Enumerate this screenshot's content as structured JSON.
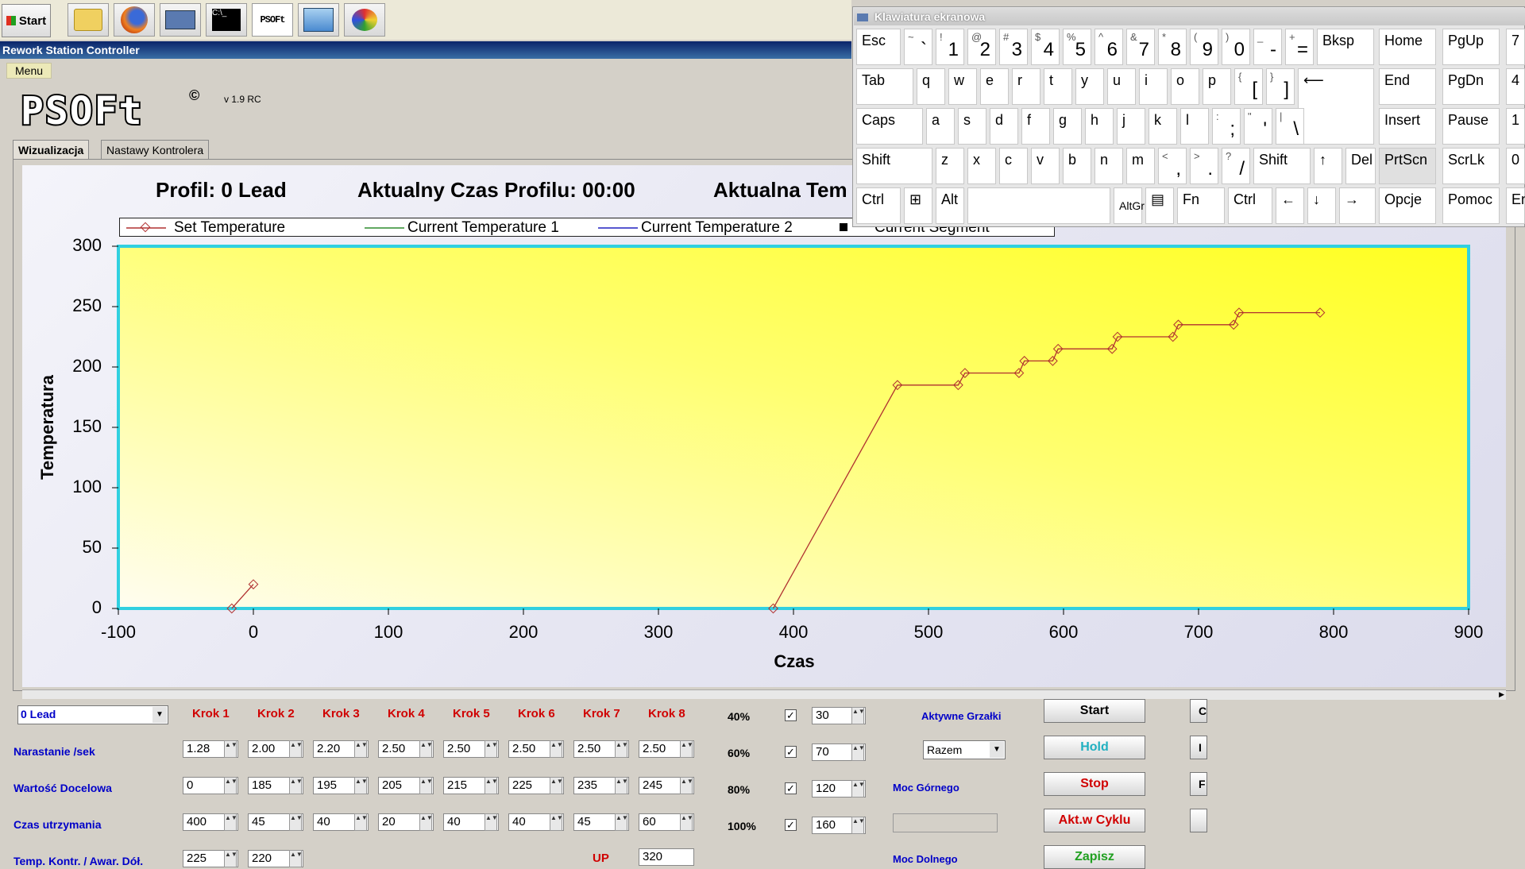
{
  "taskbar": {
    "start_label": "Start",
    "psoft_label": "PSOFt"
  },
  "window": {
    "title": "Rework Station Controller",
    "menu_label": "Menu",
    "logo_text": "PSOFt",
    "copyright": "©",
    "version": "v 1.9 RC"
  },
  "tabs": [
    {
      "label": "Wizualizacja"
    },
    {
      "label": "Nastawy Kontrolera"
    }
  ],
  "header": {
    "profil": "Profil: 0 Lead",
    "czas": "Aktualny Czas Profilu: 00:00",
    "temp": "Aktualna Tem"
  },
  "legend": [
    {
      "label": "Set Temperature",
      "color": "#b03030"
    },
    {
      "label": "Current Temperature 1",
      "color": "#2e8b2e"
    },
    {
      "label": "Current Temperature 2",
      "color": "#2020c0"
    },
    {
      "label": "Current Segment",
      "color": "#000000"
    }
  ],
  "chart_data": {
    "type": "line",
    "xlabel": "Czas",
    "ylabel": "Temperatura",
    "xlim": [
      -100,
      900
    ],
    "ylim": [
      0,
      300
    ],
    "xticks": [
      -100,
      0,
      100,
      200,
      300,
      400,
      500,
      600,
      700,
      800,
      900
    ],
    "yticks": [
      0,
      50,
      100,
      150,
      200,
      250,
      300
    ],
    "series": [
      {
        "name": "Set Temperature",
        "color": "#b03030",
        "segments": [
          [
            [
              -16,
              0
            ],
            [
              0,
              20
            ]
          ],
          [
            [
              385,
              0
            ],
            [
              477,
              185
            ],
            [
              522,
              185
            ],
            [
              527,
              195
            ],
            [
              567,
              195
            ],
            [
              571,
              205
            ],
            [
              592,
              205
            ],
            [
              596,
              215
            ],
            [
              636,
              215
            ],
            [
              640,
              225
            ],
            [
              681,
              225
            ],
            [
              685,
              235
            ],
            [
              726,
              235
            ],
            [
              730,
              245
            ],
            [
              790,
              245
            ]
          ]
        ]
      }
    ]
  },
  "keyboard": {
    "title": "Klawiatura ekranowa",
    "rows": [
      [
        {
          "t": "Esc"
        },
        {
          "s": "~",
          "l": "`"
        },
        {
          "s": "!",
          "l": "1"
        },
        {
          "s": "@",
          "l": "2"
        },
        {
          "s": "#",
          "l": "3"
        },
        {
          "s": "$",
          "l": "4"
        },
        {
          "s": "%",
          "l": "5"
        },
        {
          "s": "^",
          "l": "6"
        },
        {
          "s": "&",
          "l": "7"
        },
        {
          "s": "*",
          "l": "8"
        },
        {
          "s": "(",
          "l": "9"
        },
        {
          "s": ")",
          "l": "0"
        },
        {
          "s": "_",
          "l": "-"
        },
        {
          "s": "+",
          "l": "="
        },
        {
          "t": "Bksp"
        },
        {
          "t": "Home"
        },
        {
          "t": "PgUp"
        },
        {
          "t": "7"
        }
      ],
      [
        {
          "t": "Tab"
        },
        {
          "t": "q"
        },
        {
          "t": "w"
        },
        {
          "t": "e"
        },
        {
          "t": "r"
        },
        {
          "t": "t"
        },
        {
          "t": "y"
        },
        {
          "t": "u"
        },
        {
          "t": "i"
        },
        {
          "t": "o"
        },
        {
          "t": "p"
        },
        {
          "s": "{",
          "l": "["
        },
        {
          "s": "}",
          "l": "]"
        },
        {
          "t": "⟵"
        },
        {
          "t": "End"
        },
        {
          "t": "PgDn"
        },
        {
          "t": "4"
        }
      ],
      [
        {
          "t": "Caps"
        },
        {
          "t": "a"
        },
        {
          "t": "s"
        },
        {
          "t": "d"
        },
        {
          "t": "f"
        },
        {
          "t": "g"
        },
        {
          "t": "h"
        },
        {
          "t": "j"
        },
        {
          "t": "k"
        },
        {
          "t": "l"
        },
        {
          "s": ":",
          "l": ";"
        },
        {
          "s": "\"",
          "l": "'"
        },
        {
          "s": "|",
          "l": "\\"
        },
        {
          "t": "Insert"
        },
        {
          "t": "Pause"
        },
        {
          "t": "1"
        }
      ],
      [
        {
          "t": "Shift"
        },
        {
          "t": "z"
        },
        {
          "t": "x"
        },
        {
          "t": "c"
        },
        {
          "t": "v"
        },
        {
          "t": "b"
        },
        {
          "t": "n"
        },
        {
          "t": "m"
        },
        {
          "s": "<",
          "l": ","
        },
        {
          "s": ">",
          "l": "."
        },
        {
          "s": "?",
          "l": "/"
        },
        {
          "t": "Shift"
        },
        {
          "t": "↑"
        },
        {
          "t": "Del"
        },
        {
          "t": "PrtScn"
        },
        {
          "t": "ScrLk"
        },
        {
          "t": "0"
        }
      ],
      [
        {
          "t": "Ctrl"
        },
        {
          "t": "⊞"
        },
        {
          "t": "Alt"
        },
        {
          "t": ""
        },
        {
          "t": "AltGr"
        },
        {
          "t": "▤"
        },
        {
          "t": "Fn"
        },
        {
          "t": "Ctrl"
        },
        {
          "t": "←"
        },
        {
          "t": "↓"
        },
        {
          "t": "→"
        },
        {
          "t": "Opcje"
        },
        {
          "t": "Pomoc"
        },
        {
          "t": "En"
        }
      ]
    ]
  },
  "controls": {
    "profile_select": "0 Lead",
    "kroki": [
      "Krok 1",
      "Krok 2",
      "Krok 3",
      "Krok 4",
      "Krok 5",
      "Krok 6",
      "Krok 7",
      "Krok 8"
    ],
    "rows": [
      {
        "label": "Narastanie /sek",
        "values": [
          "1.28",
          "2.00",
          "2.20",
          "2.50",
          "2.50",
          "2.50",
          "2.50",
          "2.50"
        ]
      },
      {
        "label": "Wartość Docelowa",
        "values": [
          "0",
          "185",
          "195",
          "205",
          "215",
          "225",
          "235",
          "245"
        ]
      },
      {
        "label": "Czas utrzymania",
        "values": [
          "400",
          "45",
          "40",
          "20",
          "40",
          "40",
          "45",
          "60"
        ]
      },
      {
        "label": "Temp. Kontr. / Awar. Dół.",
        "values": [
          "225",
          "220"
        ]
      }
    ],
    "percents": [
      {
        "label": "40%",
        "value": "30",
        "checked": "✓"
      },
      {
        "label": "60%",
        "value": "70",
        "checked": "✓"
      },
      {
        "label": "80%",
        "value": "120",
        "checked": "✓"
      },
      {
        "label": "100%",
        "value": "160",
        "checked": "✓"
      }
    ],
    "up_label": "UP",
    "up_value": "320",
    "aktywne_grzalki": "Aktywne Grzałki",
    "razem_select": "Razem",
    "moc_gornego": "Moc Górnego",
    "moc_dolnego": "Moc Dolnego",
    "buttons": [
      {
        "label": "Start",
        "color": "#000000"
      },
      {
        "label": "Hold",
        "color": "#20b0c0"
      },
      {
        "label": "Stop",
        "color": "#d00000"
      },
      {
        "label": "Akt.w Cyklu",
        "color": "#d00000"
      },
      {
        "label": "Zapisz",
        "color": "#20a020"
      }
    ],
    "edge_buttons": [
      "C",
      "I",
      "F",
      ""
    ]
  }
}
